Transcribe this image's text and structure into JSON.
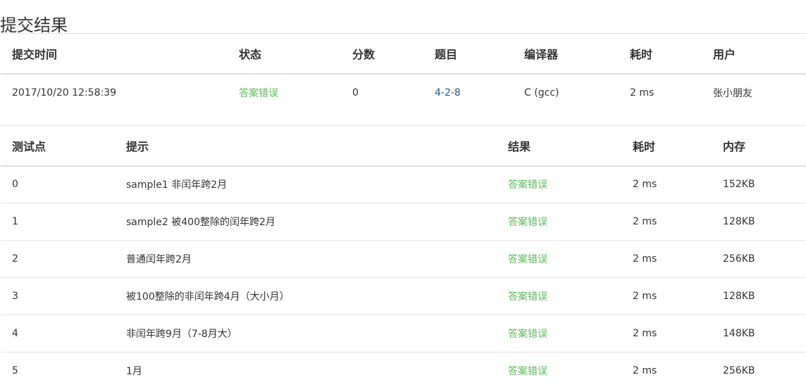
{
  "page": {
    "title": "提交结果"
  },
  "colors": {
    "status_wrong": "#5cb85c",
    "link": "#1f5a8c",
    "divider": "#dddddd"
  },
  "summary": {
    "headers": [
      "提交时间",
      "状态",
      "分数",
      "题目",
      "编译器",
      "耗时",
      "用户"
    ],
    "row": {
      "submit_time": "2017/10/20 12:58:39",
      "status": "答案错误",
      "score": "0",
      "problem": "4-2-8",
      "compiler": "C (gcc)",
      "time": "2 ms",
      "user": "张小朋友"
    }
  },
  "cases": {
    "headers": [
      "测试点",
      "提示",
      "结果",
      "耗时",
      "内存"
    ],
    "rows": [
      {
        "id": "0",
        "hint": "sample1 非闰年跨2月",
        "result": "答案错误",
        "time": "2 ms",
        "memory": "152KB"
      },
      {
        "id": "1",
        "hint": "sample2 被400整除的闰年跨2月",
        "result": "答案错误",
        "time": "2 ms",
        "memory": "128KB"
      },
      {
        "id": "2",
        "hint": "普通闰年跨2月",
        "result": "答案错误",
        "time": "2 ms",
        "memory": "256KB"
      },
      {
        "id": "3",
        "hint": "被100整除的非闰年跨4月（大小月）",
        "result": "答案错误",
        "time": "2 ms",
        "memory": "128KB"
      },
      {
        "id": "4",
        "hint": "非闰年跨9月（7-8月大）",
        "result": "答案错误",
        "time": "2 ms",
        "memory": "148KB"
      },
      {
        "id": "5",
        "hint": "1月",
        "result": "答案错误",
        "time": "2 ms",
        "memory": "256KB"
      }
    ]
  }
}
